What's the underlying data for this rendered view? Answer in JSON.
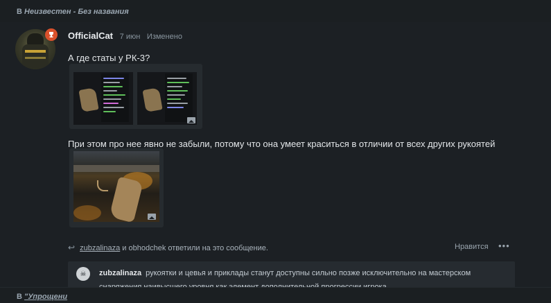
{
  "breadcrumb": {
    "prefix": "В",
    "location": "Неизвестен - Без названия"
  },
  "post": {
    "author": "OfficialCat",
    "date": "7 июн",
    "edited": "Изменено",
    "text1": "А где статы у РК-3?",
    "text2": "При этом про нее явно не забыли, потому что она умеет краситься в отличии от всех других рукоятей"
  },
  "replies": {
    "user1": "zubzalinaza",
    "conj": "и",
    "user2": "obhodchek",
    "suffix": "ответили на это сообщение.",
    "likes_label": "Нравится",
    "more_label": "•••"
  },
  "quote": {
    "author": "zubzalinaza",
    "text": "рукоятки и цевья и приклады станут доступны сильно позже исключительно на мастерском снаряжения наивысшего уровня как элемент дополнительной прогрессии игрока"
  },
  "next_thread": {
    "prefix": "В",
    "location": "\"Упрощени"
  },
  "icons": {
    "badge": "trophy-icon",
    "reply": "reply-arrow-icon",
    "image": "image-icon"
  },
  "colors": {
    "badge": "#d9512c",
    "background": "#1c2024"
  }
}
